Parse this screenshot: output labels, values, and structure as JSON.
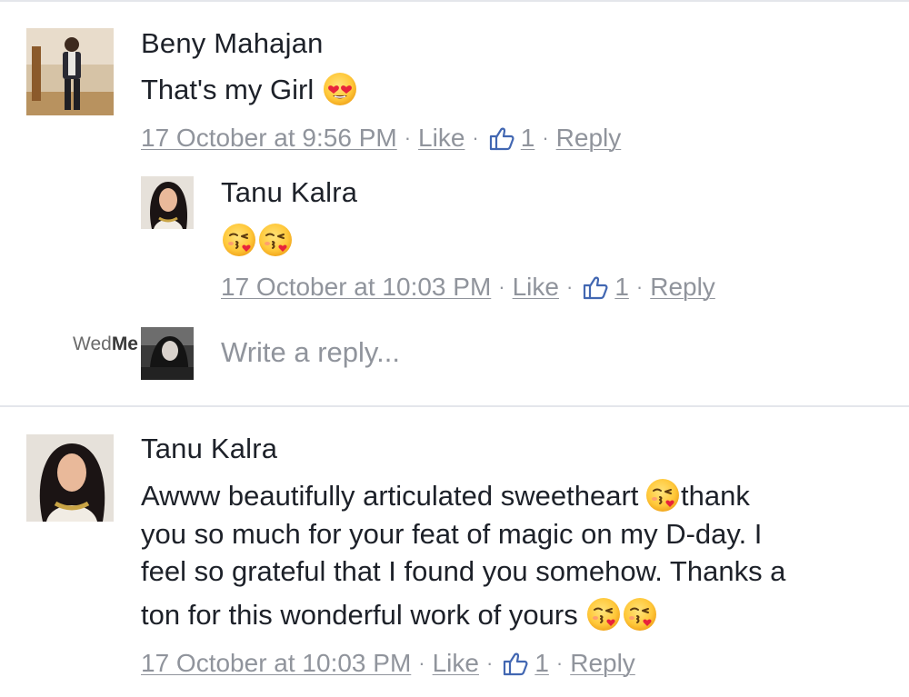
{
  "comments": [
    {
      "author": "Beny Mahajan",
      "text": "That's my Girl",
      "text_emojis": [
        "smiling-face-with-heart-eyes"
      ],
      "timestamp": "17 October at 9:56 PM",
      "like_label": "Like",
      "like_count": "1",
      "reply_label": "Reply"
    },
    {
      "author": "Tanu Kalra",
      "text": "",
      "text_emojis": [
        "face-blowing-a-kiss",
        "face-blowing-a-kiss"
      ],
      "timestamp": "17 October at 10:03 PM",
      "like_label": "Like",
      "like_count": "1",
      "reply_label": "Reply"
    },
    {
      "author": "Tanu Kalra",
      "lines": [
        "Awww beautifully articulated sweetheart",
        "thank",
        "you so much for your feat of magic on my D-day. I",
        "feel so grateful that I found you somehow. Thanks a",
        "ton for this wonderful work of yours"
      ],
      "text_emojis": [
        "face-blowing-a-kiss",
        "face-blowing-a-kiss",
        "face-blowing-a-kiss"
      ],
      "timestamp": "17 October at 10:03 PM",
      "like_label": "Like",
      "like_count": "1",
      "reply_label": "Reply"
    }
  ],
  "reply_box": {
    "placeholder": "Write a reply..."
  },
  "watermark": {
    "part1": "Wed",
    "part2": "Me"
  },
  "icons": {
    "like": "thumbs-up-icon",
    "heart_eyes": "smiling-face-with-heart-eyes-emoji",
    "kiss": "face-blowing-a-kiss-emoji"
  },
  "colors": {
    "text": "#1d2129",
    "meta": "#90949c",
    "separator": "#e4e6eb"
  }
}
